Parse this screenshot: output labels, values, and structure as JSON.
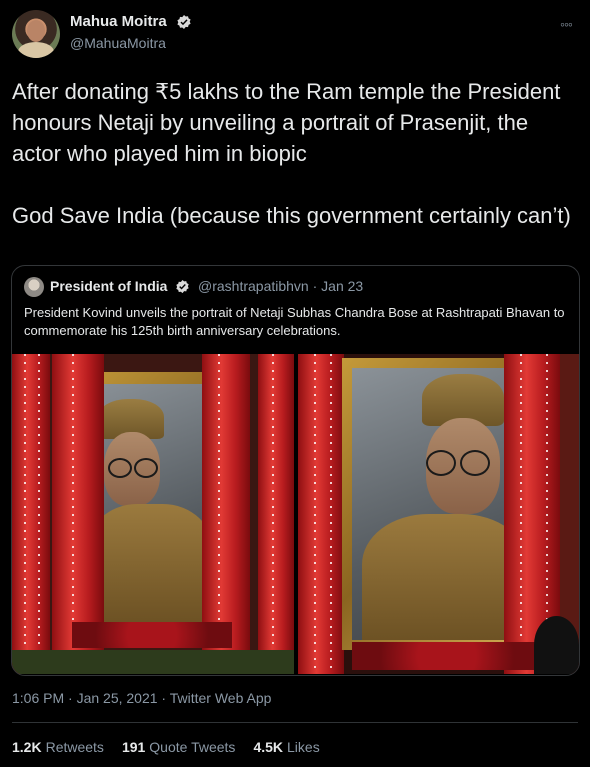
{
  "author": {
    "display_name": "Mahua Moitra",
    "handle": "@MahuaMoitra",
    "verified": true
  },
  "menu_icon": "more-horizontal-icon",
  "tweet": {
    "text": "After donating ₹5 lakhs to the Ram temple the President honours Netaji by unveiling a portrait of Prasenjit, the actor who played him in biopic\n\nGod Save India (because this government certainly can’t)",
    "timestamp": "1:06 PM · Jan 25, 2021 · Twitter Web App"
  },
  "quoted_tweet": {
    "display_name": "President of India",
    "handle_date": "@rashtrapatibhvn · Jan 23",
    "verified": true,
    "text": "President Kovind unveils the portrait of Netaji Subhas Chandra Bose at Rashtrapati Bhavan to commemorate his 125th birth anniversary celebrations."
  },
  "stats": {
    "retweets_count": "1.2K",
    "retweets_label": "Retweets",
    "quote_count": "191",
    "quote_label": "Quote Tweets",
    "likes_count": "4.5K",
    "likes_label": "Likes"
  },
  "colors": {
    "background": "#000000",
    "text_primary": "#e7e9ea",
    "text_secondary": "#8b98a5",
    "verified_badge": "#d9d9d9",
    "divider": "#2f3336"
  }
}
